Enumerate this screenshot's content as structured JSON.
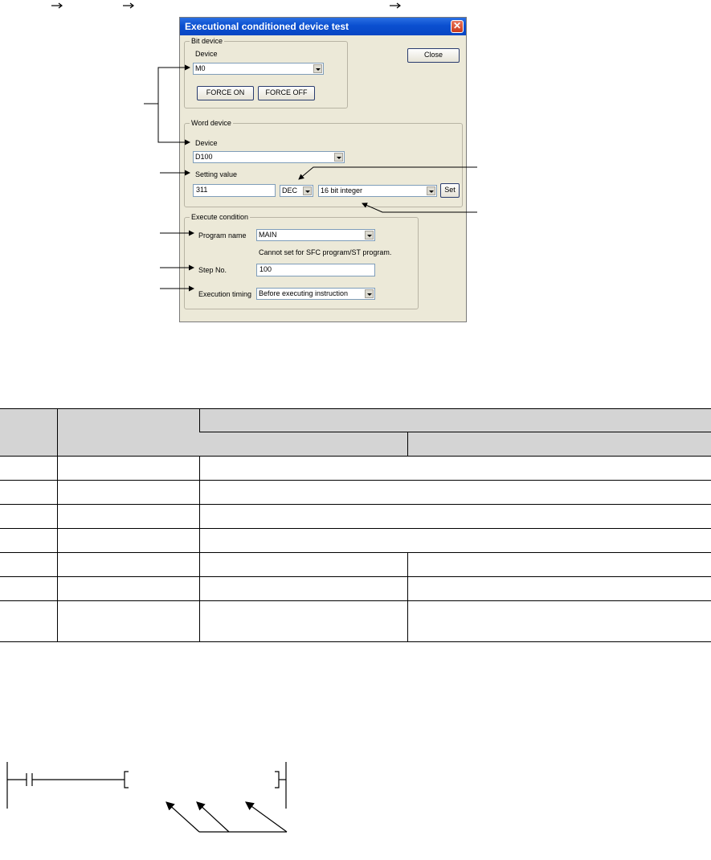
{
  "dialog": {
    "title": "Executional conditioned device test",
    "close_button": "Close",
    "bit_device": {
      "group_label": "Bit device",
      "device_label": "Device",
      "device_value": "M0",
      "force_on": "FORCE ON",
      "force_off": "FORCE OFF"
    },
    "word_device": {
      "group_label": "Word device",
      "device_label": "Device",
      "device_value": "D100",
      "setting_value_label": "Setting value",
      "setting_value": "311",
      "radix_value": "DEC",
      "data_type_value": "16 bit integer",
      "set_button": "Set"
    },
    "execute_condition": {
      "group_label": "Execute condition",
      "program_name_label": "Program name",
      "program_name_value": "MAIN",
      "note": "Cannot set for SFC program/ST program.",
      "step_no_label": "Step No.",
      "step_no_value": "100",
      "execution_timing_label": "Execution timing",
      "execution_timing_value": "Before executing instruction"
    }
  },
  "colors": {
    "titlebar": "#0a4fd0",
    "dialog_bg": "#ece9d8",
    "table_header_bg": "#d4d4d4"
  }
}
